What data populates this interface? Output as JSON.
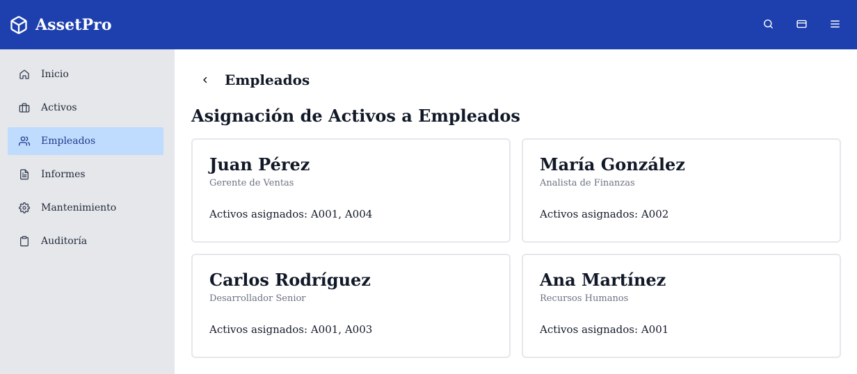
{
  "app": {
    "name": "AssetPro"
  },
  "header": {
    "actions": [
      {
        "icon": "search-icon"
      },
      {
        "icon": "credit-card-icon"
      },
      {
        "icon": "menu-icon"
      }
    ]
  },
  "sidebar": {
    "items": [
      {
        "label": "Inicio",
        "icon": "home-icon",
        "active": false
      },
      {
        "label": "Activos",
        "icon": "briefcase-icon",
        "active": false
      },
      {
        "label": "Empleados",
        "icon": "users-icon",
        "active": true
      },
      {
        "label": "Informes",
        "icon": "file-text-icon",
        "active": false
      },
      {
        "label": "Mantenimiento",
        "icon": "gear-icon",
        "active": false
      },
      {
        "label": "Auditoría",
        "icon": "clipboard-icon",
        "active": false
      }
    ]
  },
  "main": {
    "breadcrumb_title": "Empleados",
    "heading": "Asignación de Activos a Empleados",
    "employees": [
      {
        "name": "Juan Pérez",
        "role": "Gerente de Ventas",
        "assets": "Activos asignados: A001, A004"
      },
      {
        "name": "María González",
        "role": "Analista de Finanzas",
        "assets": "Activos asignados: A002"
      },
      {
        "name": "Carlos Rodríguez",
        "role": "Desarrollador Senior",
        "assets": "Activos asignados: A001, A003"
      },
      {
        "name": "Ana Martínez",
        "role": "Recursos Humanos",
        "assets": "Activos asignados: A001"
      }
    ]
  },
  "colors": {
    "header_bg": "#1e40af",
    "sidebar_bg": "#e5e7eb",
    "active_item_bg": "#bfdbfe",
    "card_border": "#e5e7eb",
    "muted_text": "#6b7280"
  }
}
